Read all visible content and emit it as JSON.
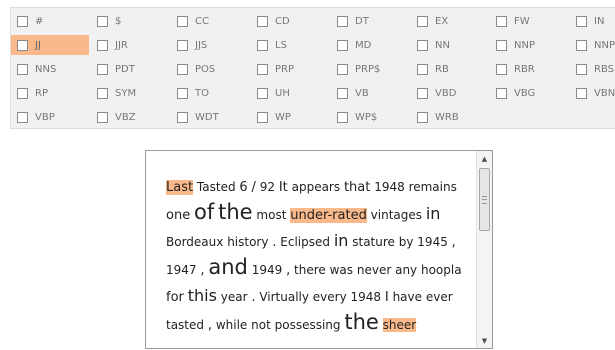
{
  "tag_rows": [
    [
      {
        "label": "#",
        "checked": false
      },
      {
        "label": "$",
        "checked": false
      },
      {
        "label": "CC",
        "checked": false
      },
      {
        "label": "CD",
        "checked": false
      },
      {
        "label": "DT",
        "checked": false
      },
      {
        "label": "EX",
        "checked": false
      },
      {
        "label": "FW",
        "checked": false
      },
      {
        "label": "IN",
        "checked": false
      }
    ],
    [
      {
        "label": "JJ",
        "checked": true
      },
      {
        "label": "JJR",
        "checked": false
      },
      {
        "label": "JJS",
        "checked": false
      },
      {
        "label": "LS",
        "checked": false
      },
      {
        "label": "MD",
        "checked": false
      },
      {
        "label": "NN",
        "checked": false
      },
      {
        "label": "NNP",
        "checked": false
      },
      {
        "label": "NNPS",
        "checked": false
      }
    ],
    [
      {
        "label": "NNS",
        "checked": false
      },
      {
        "label": "PDT",
        "checked": false
      },
      {
        "label": "POS",
        "checked": false
      },
      {
        "label": "PRP",
        "checked": false
      },
      {
        "label": "PRP$",
        "checked": false
      },
      {
        "label": "RB",
        "checked": false
      },
      {
        "label": "RBR",
        "checked": false
      },
      {
        "label": "RBS",
        "checked": false
      }
    ],
    [
      {
        "label": "RP",
        "checked": false
      },
      {
        "label": "SYM",
        "checked": false
      },
      {
        "label": "TO",
        "checked": false
      },
      {
        "label": "UH",
        "checked": false
      },
      {
        "label": "VB",
        "checked": false
      },
      {
        "label": "VBD",
        "checked": false
      },
      {
        "label": "VBG",
        "checked": false
      },
      {
        "label": "VBN",
        "checked": false
      }
    ],
    [
      {
        "label": "VBP",
        "checked": false
      },
      {
        "label": "VBZ",
        "checked": false
      },
      {
        "label": "WDT",
        "checked": false
      },
      {
        "label": "WP",
        "checked": false
      },
      {
        "label": "WP$",
        "checked": false
      },
      {
        "label": "WRB",
        "checked": false
      }
    ]
  ],
  "highlight_color": "#fab98a",
  "text_tokens": [
    {
      "t": "Last",
      "hl": true,
      "size": "m"
    },
    {
      "t": "Tasted",
      "size": "s"
    },
    {
      "t": "6",
      "size": "m"
    },
    {
      "t": "/",
      "size": "m"
    },
    {
      "t": "92",
      "size": "s"
    },
    {
      "t": "It",
      "size": "m"
    },
    {
      "t": "appears",
      "size": "s"
    },
    {
      "t": "that",
      "size": "m"
    },
    {
      "t": "1948",
      "size": "s"
    },
    {
      "t": "remains",
      "size": "s"
    },
    {
      "t": "one",
      "size": "m"
    },
    {
      "t": "of",
      "size": "xl"
    },
    {
      "t": "the",
      "size": "xl"
    },
    {
      "t": "most",
      "size": "s"
    },
    {
      "t": "under-rated",
      "hl": true,
      "size": "m"
    },
    {
      "t": "vintages",
      "size": "s"
    },
    {
      "t": "in",
      "size": "l"
    },
    {
      "t": "Bordeaux",
      "size": "s"
    },
    {
      "t": "history",
      "size": "s"
    },
    {
      "t": ".",
      "size": "m"
    },
    {
      "t": "Eclipsed",
      "size": "s"
    },
    {
      "t": "in",
      "size": "l"
    },
    {
      "t": "stature",
      "size": "s"
    },
    {
      "t": "by",
      "size": "s"
    },
    {
      "t": "1945",
      "size": "s"
    },
    {
      "t": ",",
      "size": "m"
    },
    {
      "t": "1947",
      "size": "s"
    },
    {
      "t": ",",
      "size": "m"
    },
    {
      "t": "and",
      "size": "xl"
    },
    {
      "t": "1949",
      "size": "s"
    },
    {
      "t": ",",
      "size": "m"
    },
    {
      "t": "there",
      "size": "s"
    },
    {
      "t": "was",
      "size": "s"
    },
    {
      "t": "never",
      "size": "s"
    },
    {
      "t": "any",
      "size": "s"
    },
    {
      "t": "hoopla",
      "size": "s"
    },
    {
      "t": "for",
      "size": "m"
    },
    {
      "t": "this",
      "size": "l"
    },
    {
      "t": "year",
      "size": "s"
    },
    {
      "t": ".",
      "size": "m"
    },
    {
      "t": "Virtually",
      "size": "s"
    },
    {
      "t": "every",
      "size": "s"
    },
    {
      "t": "1948",
      "size": "s"
    },
    {
      "t": "I",
      "size": "m"
    },
    {
      "t": "have",
      "size": "s"
    },
    {
      "t": "ever",
      "size": "s"
    },
    {
      "t": "tasted",
      "size": "s"
    },
    {
      "t": ",",
      "size": "m"
    },
    {
      "t": "while",
      "size": "s"
    },
    {
      "t": "not",
      "size": "s"
    },
    {
      "t": "possessing",
      "size": "s"
    },
    {
      "t": "the",
      "size": "xl"
    },
    {
      "t": "sheer",
      "hl": true,
      "size": "s"
    }
  ],
  "scrollbar": {
    "up_arrow": "▲",
    "down_arrow": "▼"
  }
}
